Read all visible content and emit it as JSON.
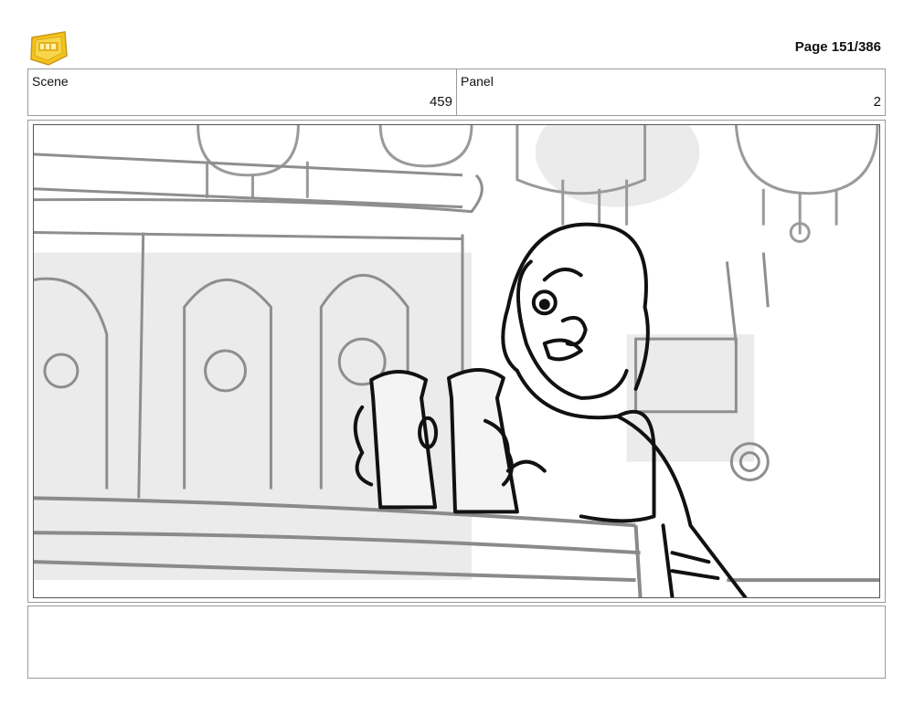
{
  "header": {
    "logo_icon": "young-jedi-adventures-logo",
    "logo_color": "#f2c41b",
    "page_label": "Page 151/386"
  },
  "info": {
    "scene_label": "Scene",
    "scene_value": "459",
    "panel_label": "Panel",
    "panel_value": "2"
  },
  "panel_image": {
    "icon": "storyboard-sketch-bartender-with-mugs"
  },
  "notes": {
    "text": ""
  }
}
